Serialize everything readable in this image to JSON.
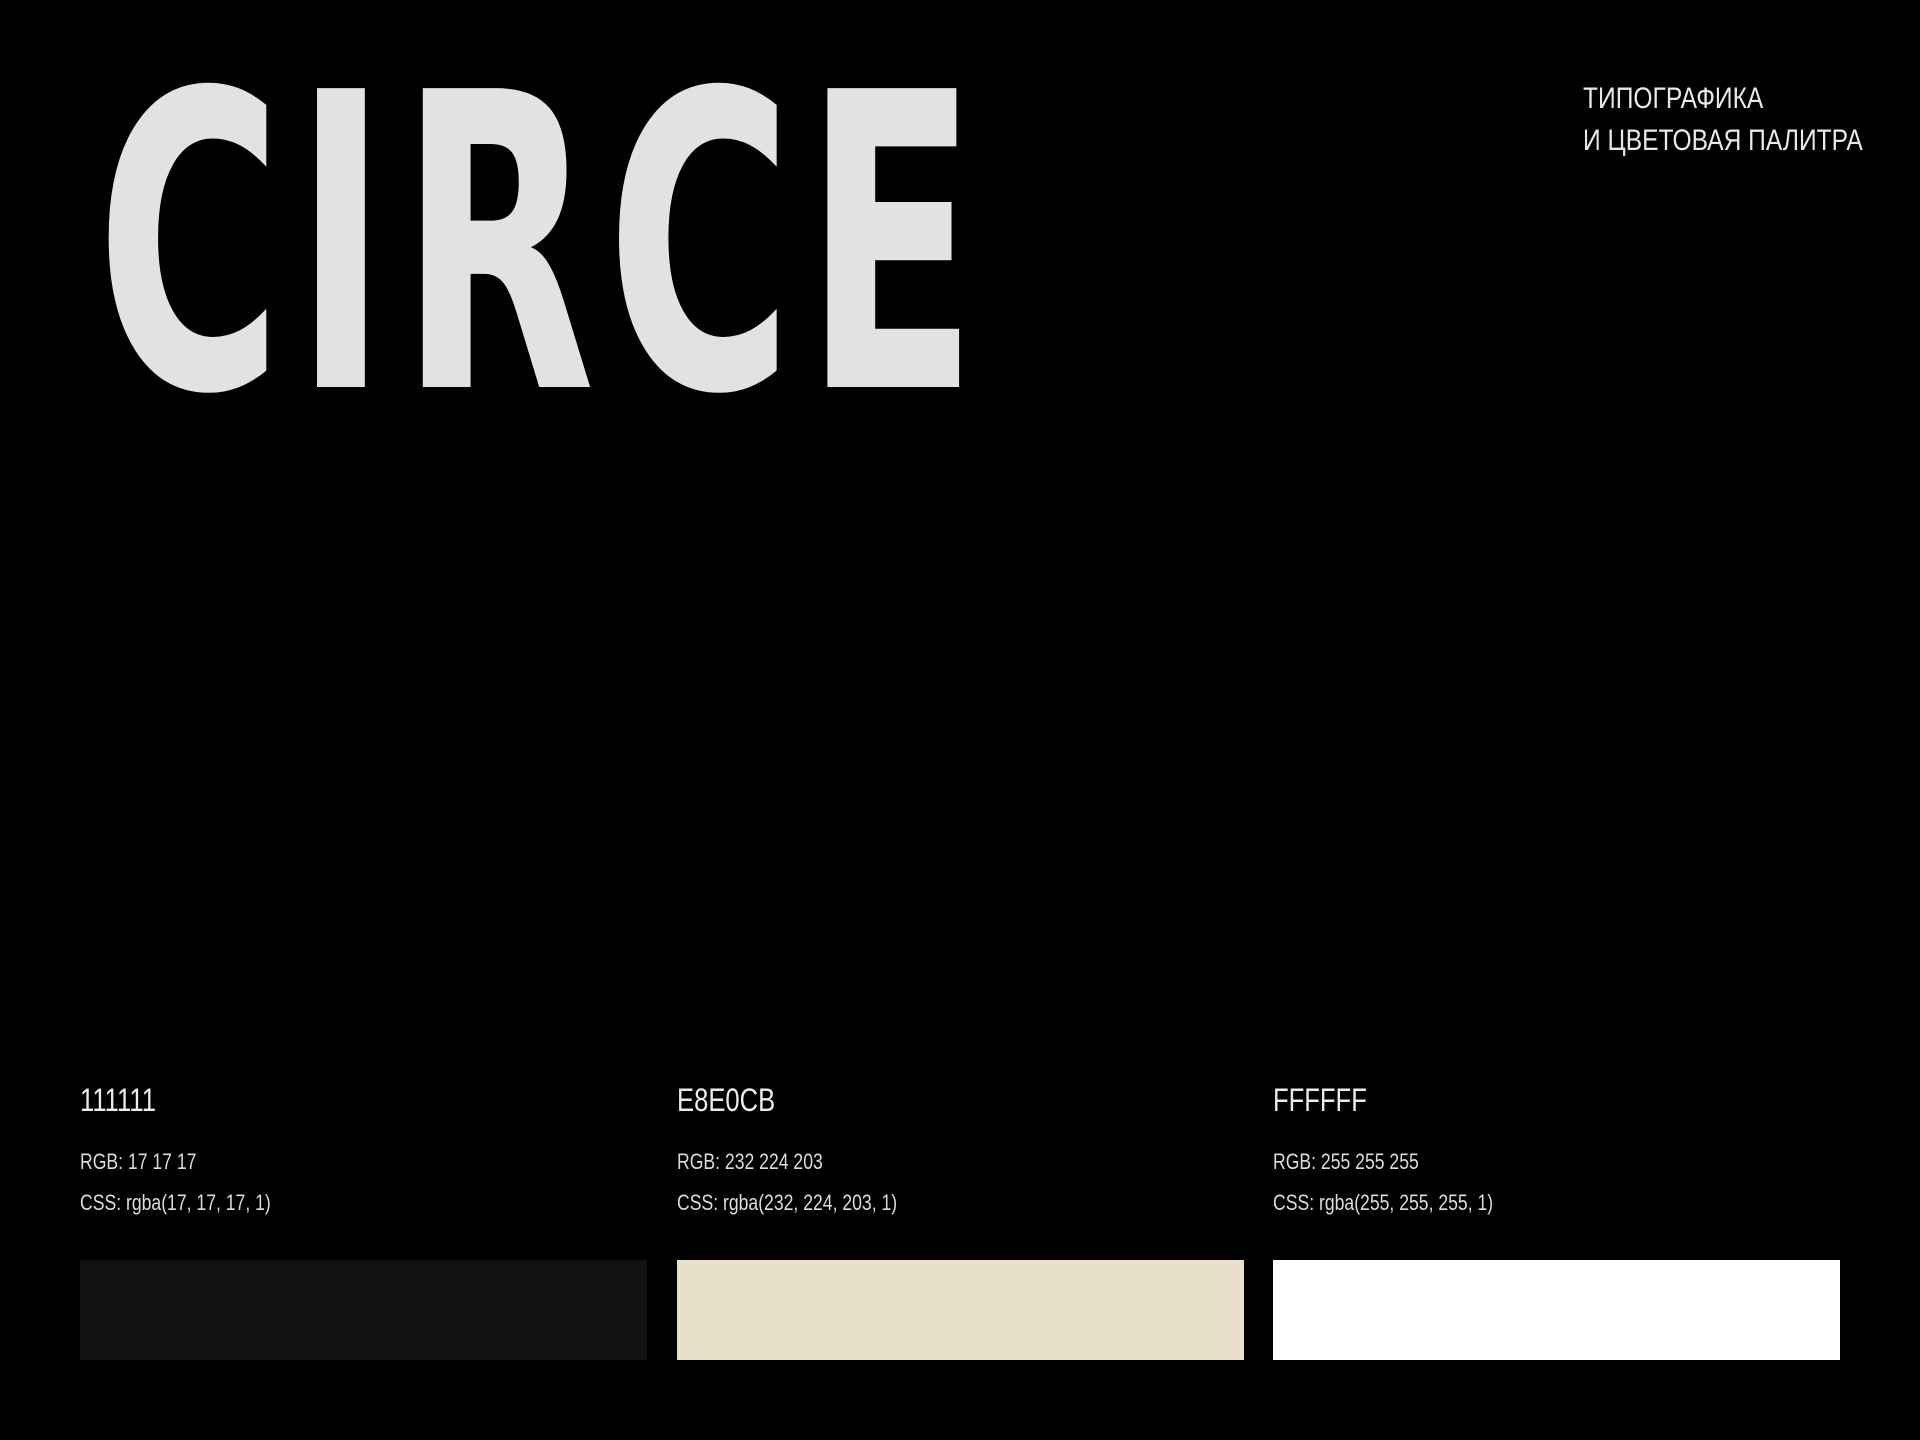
{
  "title": "CIRCE",
  "subtitle": {
    "line1": "ТИПОГРАФИКА",
    "line2": "И ЦВЕТОВАЯ ПАЛИТРА"
  },
  "palette": [
    {
      "hex": "111111",
      "rgb": "RGB: 17 17 17",
      "css": "CSS: rgba(17, 17, 17, 1)",
      "color": "#111111"
    },
    {
      "hex": "E8E0CB",
      "rgb": "RGB: 232 224 203",
      "css": "CSS: rgba(232, 224, 203, 1)",
      "color": "#E8E0CB"
    },
    {
      "hex": "FFFFFF",
      "rgb": "RGB: 255 255 255",
      "css": "CSS: rgba(255, 255, 255, 1)",
      "color": "#FFFFFF"
    }
  ],
  "colors": {
    "background": "#000000",
    "title_text": "#E2E2E2"
  }
}
